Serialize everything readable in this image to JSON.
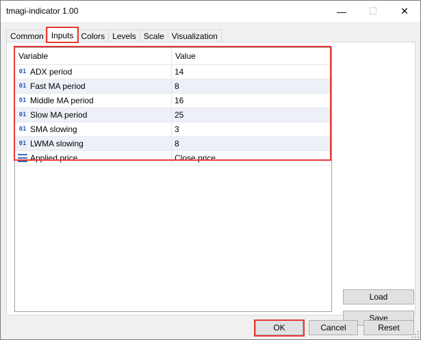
{
  "window": {
    "title": "tmagi-indicator 1.00",
    "minimize_glyph": "—",
    "maximize_glyph": "☐",
    "close_glyph": "✕"
  },
  "tabs": [
    {
      "label": "Common"
    },
    {
      "label": "Inputs",
      "active": true
    },
    {
      "label": "Colors"
    },
    {
      "label": "Levels"
    },
    {
      "label": "Scale"
    },
    {
      "label": "Visualization"
    }
  ],
  "grid": {
    "header": {
      "variable": "Variable",
      "value": "Value"
    },
    "int_icon_glyph": "01",
    "rows": [
      {
        "icon": "int-icon",
        "variable": "ADX period",
        "value": "14"
      },
      {
        "icon": "int-icon",
        "variable": "Fast MA period",
        "value": "8"
      },
      {
        "icon": "int-icon",
        "variable": "Middle MA period",
        "value": "16"
      },
      {
        "icon": "int-icon",
        "variable": "Slow MA period",
        "value": "25"
      },
      {
        "icon": "int-icon",
        "variable": "SMA slowing",
        "value": "3"
      },
      {
        "icon": "int-icon",
        "variable": "LWMA slowing",
        "value": "8"
      },
      {
        "icon": "enum-list-icon",
        "variable": "Applied price",
        "value": "Close price"
      }
    ]
  },
  "buttons": {
    "load": "Load",
    "save": "Save",
    "ok": "OK",
    "cancel": "Cancel",
    "reset": "Reset"
  },
  "colors": {
    "highlight": "#e53935",
    "icon_blue": "#2a59b8"
  }
}
